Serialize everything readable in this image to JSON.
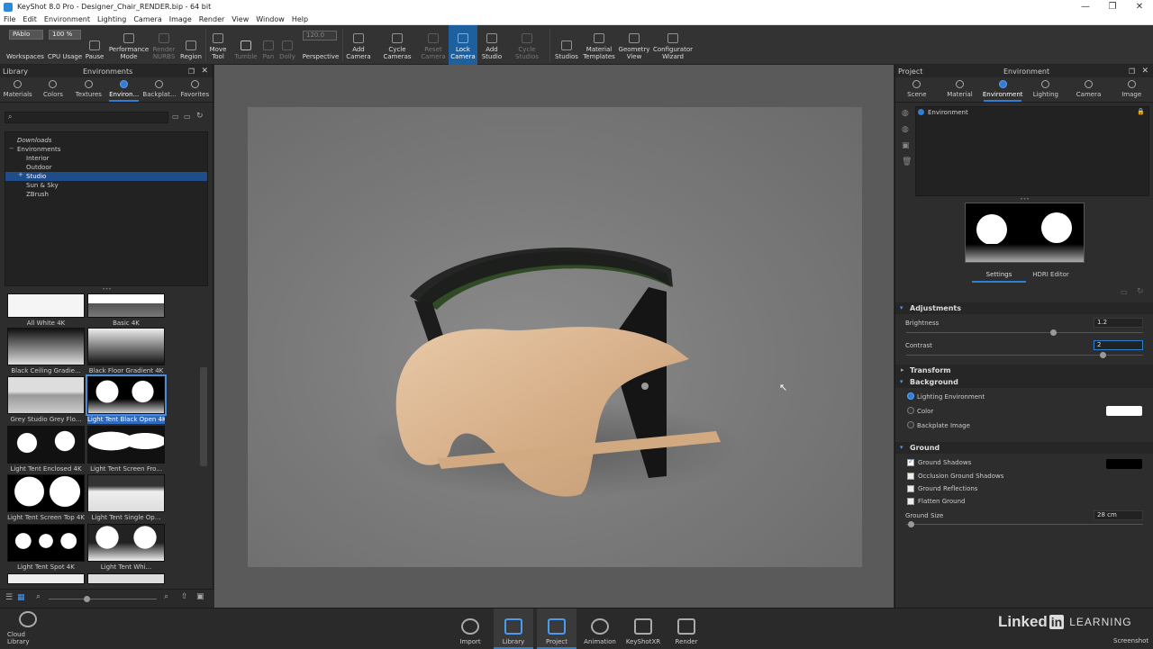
{
  "window": {
    "title": "KeyShot 8.0 Pro  -  Designer_Chair_RENDER.bip  -  64 bit",
    "minimize": "—",
    "maximize": "❐",
    "close": "✕"
  },
  "menu": [
    "File",
    "Edit",
    "Environment",
    "Lighting",
    "Camera",
    "Image",
    "Render",
    "View",
    "Window",
    "Help"
  ],
  "toolbar": {
    "workspace_value": "PAblo",
    "cpu_value": "100 %",
    "frame_value": "120.0",
    "buttons": [
      {
        "label": "Workspaces"
      },
      {
        "label": "CPU Usage"
      },
      {
        "label": "Pause"
      },
      {
        "label": "Performance\nMode"
      },
      {
        "label": "Render\nNURBS"
      },
      {
        "label": "Region"
      },
      {
        "label": "Move\nTool"
      },
      {
        "label": "Tumble"
      },
      {
        "label": "Pan"
      },
      {
        "label": "Dolly"
      },
      {
        "label": "Perspective"
      },
      {
        "label": "Add\nCamera"
      },
      {
        "label": "Cycle\nCameras"
      },
      {
        "label": "Reset\nCamera"
      },
      {
        "label": "Lock\nCamera"
      },
      {
        "label": "Add\nStudio"
      },
      {
        "label": "Cycle\nStudios"
      },
      {
        "label": "Studios"
      },
      {
        "label": "Material\nTemplates"
      },
      {
        "label": "Geometry\nView"
      },
      {
        "label": "Configurator\nWizard"
      }
    ]
  },
  "library": {
    "header": "Library",
    "title": "Environments",
    "tabs": [
      "Materials",
      "Colors",
      "Textures",
      "Environ...",
      "Backplat...",
      "Favorites"
    ],
    "tree": [
      "Downloads",
      "Environments",
      "Interior",
      "Outdoor",
      "Studio",
      "Sun & Sky",
      "ZBrush"
    ],
    "thumbnails": [
      "All White 4K",
      "Basic 4K",
      "Black Ceiling Gradie...",
      "Black Floor Gradient 4K",
      "Grey Studio Grey Flo...",
      "Light Tent Black Open 4K",
      "Light Tent Enclosed 4K",
      "Light Tent Screen Fro...",
      "Light Tent Screen Top 4K",
      "Light Tent Single Op...",
      "Light Tent Spot 4K",
      "Light Tent Whi..."
    ]
  },
  "project": {
    "header": "Project",
    "title": "Environment",
    "tabs": [
      "Scene",
      "Material",
      "Environment",
      "Lighting",
      "Camera",
      "Image"
    ],
    "env_list_item": "Environment",
    "subtabs": [
      "Settings",
      "HDRI Editor"
    ],
    "sections": {
      "adjustments": "Adjustments",
      "brightness_label": "Brightness",
      "brightness_value": "1.2",
      "brightness_level": 0.62,
      "contrast_label": "Contrast",
      "contrast_value": "2",
      "contrast_level": 0.83,
      "transform": "Transform",
      "background": "Background",
      "bg_options": [
        "Lighting Environment",
        "Color",
        "Backplate Image"
      ],
      "ground": "Ground",
      "ground_options": [
        {
          "label": "Ground Shadows",
          "checked": true
        },
        {
          "label": "Occlusion Ground Shadows",
          "checked": false
        },
        {
          "label": "Ground Reflections",
          "checked": false
        },
        {
          "label": "Flatten Ground",
          "checked": false
        }
      ],
      "ground_size_label": "Ground Size",
      "ground_size_value": "28 cm",
      "ground_size_level": 0.02
    }
  },
  "bottombar": {
    "cloud": "Cloud Library",
    "buttons": [
      "Import",
      "Library",
      "Project",
      "Animation",
      "KeyShotXR",
      "Render"
    ],
    "brand_linked": "Linked",
    "brand_in": "in",
    "brand_learning": "LEARNING",
    "screenshot": "Screenshot"
  },
  "colors": {
    "accent": "#2e7fd2",
    "panel": "#2d2d2d",
    "viewport": "#5a5a5a"
  }
}
